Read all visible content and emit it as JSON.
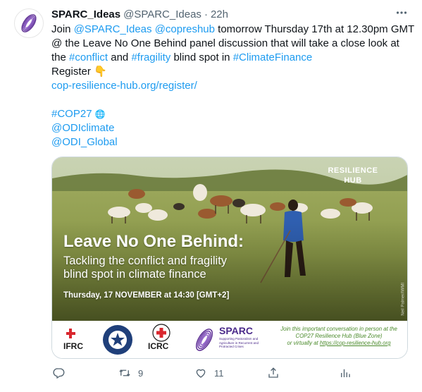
{
  "tweet": {
    "display_name": "SPARC_Ideas",
    "handle": "@SPARC_Ideas",
    "separator": "·",
    "time": "22h",
    "lines": {
      "l1_a": "Join ",
      "l1_m1": "@SPARC_Ideas",
      "l1_b": " ",
      "l1_m2": "@copreshub",
      "l1_c": " tomorrow Thursday 17th at 12.30pm GMT",
      "l2": "@ the Leave No One Behind panel discussion that will take a close look at",
      "l3_a": "the ",
      "l3_h1": "#conflict",
      "l3_b": " and ",
      "l3_h2": "#fragility",
      "l3_c": " blind spot in ",
      "l3_h3": "#ClimateFinance",
      "l4": "Register 👇",
      "l5": "cop-resilience-hub.org/register/",
      "l6": "#COP27",
      "l6_emoji": "🌐",
      "l7": "@ODIclimate",
      "l8": "@ODI_Global"
    }
  },
  "media": {
    "hub_line1": "RESILIENCE",
    "hub_line2": "HUB",
    "title": "Leave No One Behind:",
    "subtitle_1": "Tackling the conflict and fragility",
    "subtitle_2": "blind spot in climate finance",
    "date": "Thursday, 17 NOVEMBER at 14:30 [GMT+2]",
    "credit": "Neil Palmer/IWMI",
    "logos": {
      "ifrc": "IFRC",
      "ne_ring": "NEAR EAST FOUNDATION",
      "icrc": "ICRC",
      "sparc": "SPARC",
      "sparc_sub": "Supporting Pastoralism and Agriculture in Recurrent and Protracted Crises",
      "join_1": "Join this important conversation in person at the",
      "join_2": "COP27 Resilience Hub (Blue Zone)",
      "join_3a": "or virtually at ",
      "join_3b": "https://cop-resilience-hub.org"
    }
  },
  "actions": {
    "retweets": "9",
    "likes": "11"
  },
  "colors": {
    "link": "#1d9bf0",
    "text": "#0f1419",
    "muted": "#536471",
    "sparc_purple": "#4b2a8b"
  }
}
